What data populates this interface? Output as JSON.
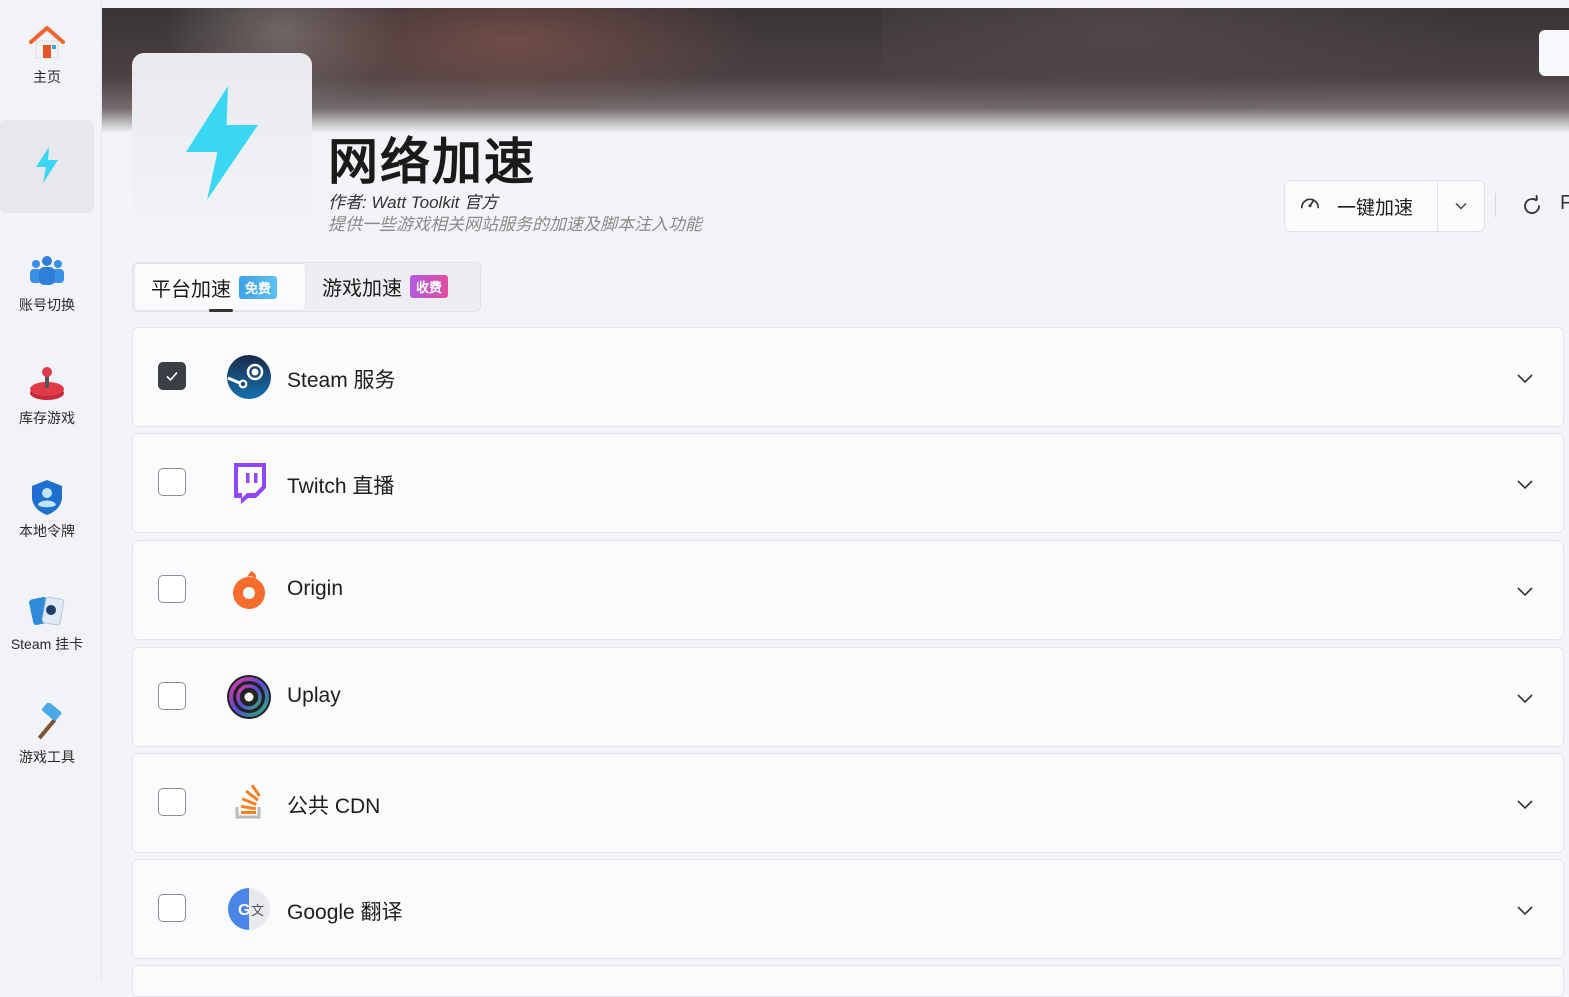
{
  "sidebar": {
    "items": [
      {
        "label": "主页",
        "icon": "home-icon"
      },
      {
        "label": "",
        "icon": "lightning-icon",
        "active": true
      },
      {
        "label": "账号切换",
        "icon": "users-icon"
      },
      {
        "label": "库存游戏",
        "icon": "joystick-icon"
      },
      {
        "label": "本地令牌",
        "icon": "shield-user-icon"
      },
      {
        "label": "Steam 挂卡",
        "icon": "cards-icon"
      },
      {
        "label": "游戏工具",
        "icon": "hammer-icon"
      }
    ]
  },
  "header": {
    "title": "网络加速",
    "author": "作者:  Watt Toolkit  官方",
    "description": "提供一些游戏相关网站服务的加速及脚本注入功能",
    "accel_button": "一键加速",
    "partial_button": "F"
  },
  "tabs": [
    {
      "label": "平台加速",
      "badge": "免费",
      "active": true
    },
    {
      "label": "游戏加速",
      "badge": "收费",
      "active": false
    }
  ],
  "services": [
    {
      "label": "Steam 服务",
      "checked": true,
      "icon": "steam-icon"
    },
    {
      "label": "Twitch 直播",
      "checked": false,
      "icon": "twitch-icon"
    },
    {
      "label": "Origin",
      "checked": false,
      "icon": "origin-icon"
    },
    {
      "label": "Uplay",
      "checked": false,
      "icon": "uplay-icon"
    },
    {
      "label": "公共 CDN",
      "checked": false,
      "icon": "stack-icon"
    },
    {
      "label": "Google 翻译",
      "checked": false,
      "icon": "google-translate-icon"
    }
  ],
  "colors": {
    "accent": "#3ad7f5",
    "checkbox_checked": "#3b3e44",
    "badge_free": "#3aa3e8",
    "badge_paid": "#c655c8"
  }
}
